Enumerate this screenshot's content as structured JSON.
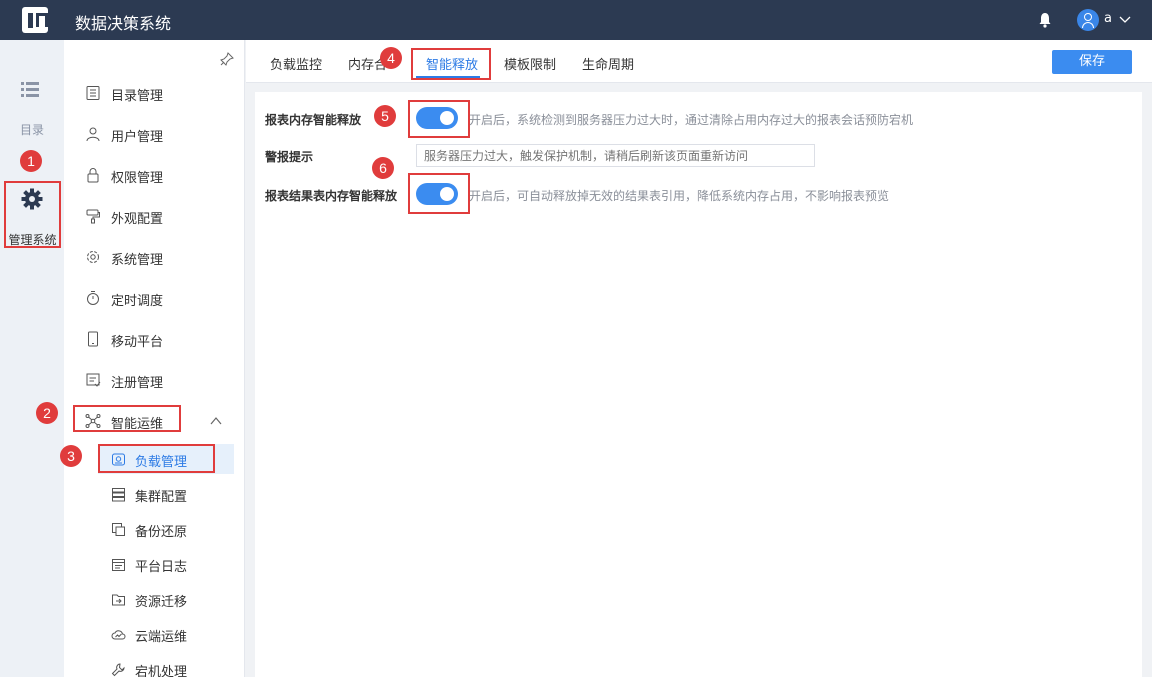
{
  "app": {
    "title": "数据决策系统",
    "username": "a"
  },
  "rail": {
    "directory_label": "目录",
    "admin_label": "管理系统"
  },
  "sidebar": {
    "items": [
      {
        "label": "目录管理",
        "icon": "catalog-icon"
      },
      {
        "label": "用户管理",
        "icon": "user-icon"
      },
      {
        "label": "权限管理",
        "icon": "lock-icon"
      },
      {
        "label": "外观配置",
        "icon": "brush-icon"
      },
      {
        "label": "系统管理",
        "icon": "gear-icon"
      },
      {
        "label": "定时调度",
        "icon": "timer-icon"
      },
      {
        "label": "移动平台",
        "icon": "mobile-icon"
      },
      {
        "label": "注册管理",
        "icon": "register-icon"
      },
      {
        "label": "智能运维",
        "icon": "network-icon"
      }
    ],
    "subitems": [
      {
        "label": "负载管理",
        "icon": "load-icon",
        "active": true
      },
      {
        "label": "集群配置",
        "icon": "cluster-icon"
      },
      {
        "label": "备份还原",
        "icon": "backup-icon"
      },
      {
        "label": "平台日志",
        "icon": "log-icon"
      },
      {
        "label": "资源迁移",
        "icon": "migrate-icon"
      },
      {
        "label": "云端运维",
        "icon": "cloud-icon"
      },
      {
        "label": "宕机处理",
        "icon": "wrench-icon"
      }
    ]
  },
  "tabs": [
    {
      "label": "负载监控"
    },
    {
      "label": "内存合"
    },
    {
      "label": "智能释放",
      "active": true
    },
    {
      "label": "模板限制"
    },
    {
      "label": "生命周期"
    }
  ],
  "toolbar": {
    "save_label": "保存"
  },
  "settings": {
    "smart_release": {
      "label": "报表内存智能释放",
      "enabled": true,
      "description": "开启后，系统检测到服务器压力过大时，通过清除占用内存过大的报表会话预防宕机"
    },
    "warning": {
      "label": "警报提示",
      "placeholder": "服务器压力过大，触发保护机制，请稍后刷新该页面重新访问"
    },
    "result_release": {
      "label": "报表结果表内存智能释放",
      "enabled": true,
      "description": "开启后，可自动释放掉无效的结果表引用，降低系统内存占用，不影响报表预览"
    }
  },
  "annotations": [
    "1",
    "2",
    "3",
    "4",
    "5",
    "6"
  ],
  "colors": {
    "topbar": "#2c3a52",
    "accent": "#3b8cf0",
    "annotation": "#e03c3c"
  }
}
